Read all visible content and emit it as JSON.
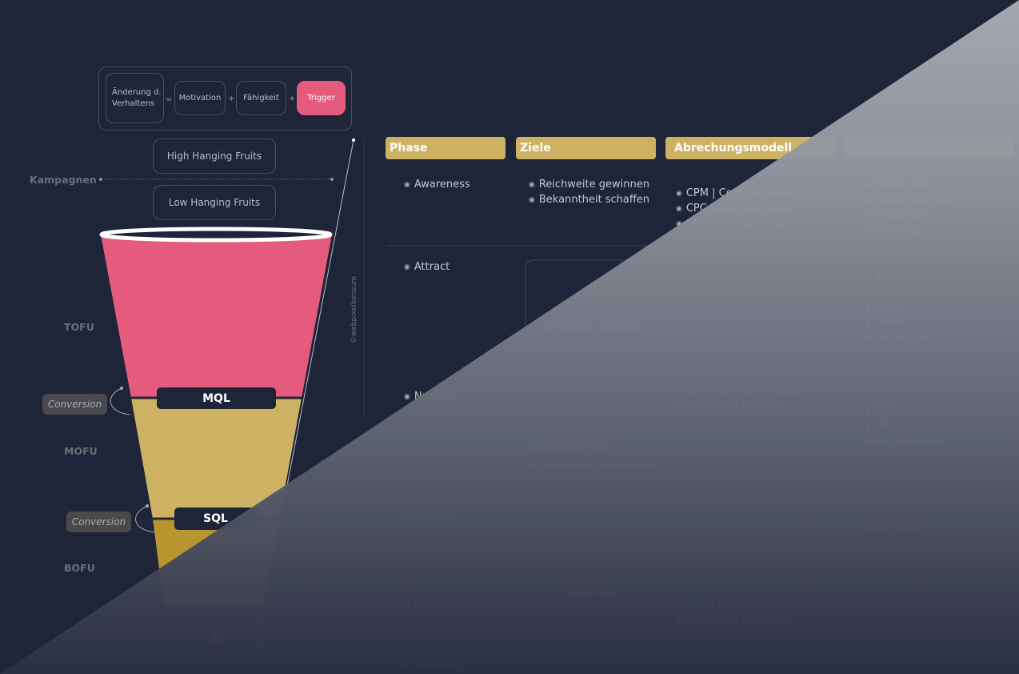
{
  "formula": {
    "result": "Änderung d. Verhaltens",
    "equals": "=",
    "plus": "+",
    "motivation": "Motivation",
    "ability": "Fähigkeit",
    "trigger": "Trigger"
  },
  "campaigns": {
    "label": "Kampagnen",
    "high": "High Hanging Fruits",
    "low": "Low Hanging Fruits"
  },
  "funnel": {
    "stages": [
      "TOFU",
      "MOFU",
      "BOFU"
    ],
    "customers_label": "Kunden",
    "mql": "MQL",
    "sql": "SQL",
    "conversion": "Conversion",
    "colors": {
      "tofu": "#e55b7d",
      "mofu": "#cdb264",
      "bofu": "#b8952f"
    }
  },
  "watermark": "©webpixelkonsum",
  "table": {
    "headers": [
      "Phase",
      "Ziele",
      "Abrechungsmodell",
      "Content-Formate"
    ],
    "rows": [
      {
        "phase": "Awareness",
        "goals": [
          "Reichweite gewinnen",
          "Bekanntheit schaffen"
        ],
        "billing": [
          "CPM | Cost per Mille",
          "CPC | Cost per Click",
          "CPV | Cost per Video-View"
        ],
        "formats": [
          "Image Ads",
          "Dokument Ads",
          "Video Ads",
          "Story Ads"
        ]
      },
      {
        "phase": "Attract",
        "goal_box": "Vertrauen aufbauen",
        "formats": [
          "Image",
          "Dokument",
          "Video",
          "Grafik",
          "Whitepaper"
        ]
      },
      {
        "phase": "Nurture",
        "goals": [
          "Überzeugen",
          "Abschluss vorbereiten"
        ],
        "billing": [
          "CPE | Cost per Engagement",
          "CPF | Cost per Fan"
        ],
        "formats": [
          "Video",
          "Whitepaper",
          "Erstgespräch"
        ]
      },
      {
        "phase": "Convert",
        "formats": [
          "Angebot"
        ]
      },
      {
        "phase": "Engage",
        "goal_box": "Abschluss",
        "billing": [
          "CPO | Cost per Order",
          "CPL | Cost per Leads"
        ]
      },
      {
        "phase": "Advocacy"
      }
    ]
  }
}
